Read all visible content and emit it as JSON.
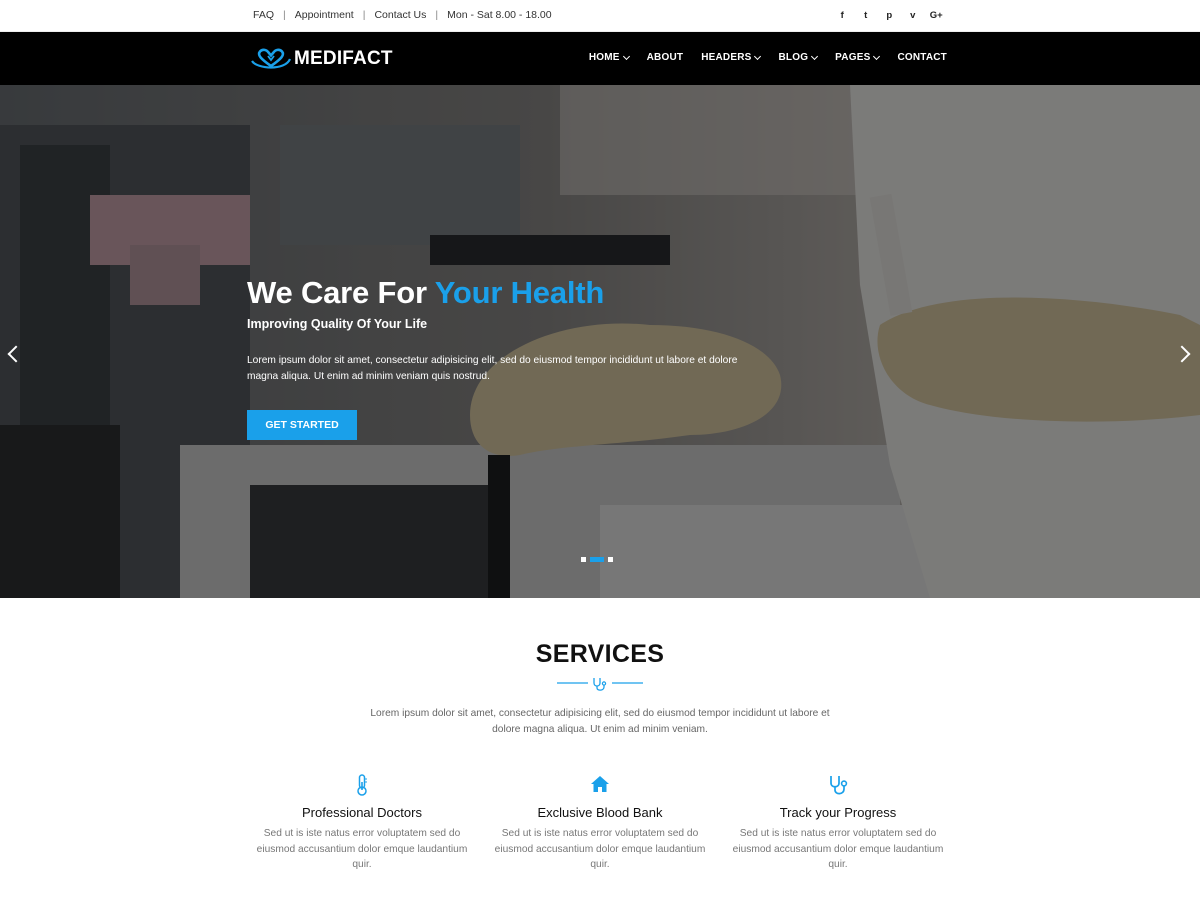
{
  "topbar": {
    "links": [
      "FAQ",
      "Appointment",
      "Contact Us"
    ],
    "hours": "Mon - Sat 8.00 - 18.00",
    "social": [
      {
        "name": "facebook-icon",
        "glyph": "f"
      },
      {
        "name": "twitter-icon",
        "glyph": "t"
      },
      {
        "name": "pinterest-icon",
        "glyph": "p"
      },
      {
        "name": "vimeo-icon",
        "glyph": "v"
      },
      {
        "name": "google-plus-icon",
        "glyph": "G+"
      }
    ]
  },
  "nav": {
    "logo_text": "MEDIFACT",
    "items": [
      {
        "label": "HOME",
        "dropdown": true
      },
      {
        "label": "ABOUT",
        "dropdown": false
      },
      {
        "label": "HEADERS",
        "dropdown": true
      },
      {
        "label": "BLOG",
        "dropdown": true
      },
      {
        "label": "PAGES",
        "dropdown": true
      },
      {
        "label": "CONTACT",
        "dropdown": false
      }
    ]
  },
  "hero": {
    "title_main": "We Care For ",
    "title_accent": "Your Health",
    "subtitle": "Improving Quality Of Your Life",
    "description": "Lorem ipsum dolor sit amet, consectetur adipisicing elit, sed do eiusmod tempor incididunt ut labore et dolore magna aliqua. Ut enim ad minim veniam quis nostrud.",
    "cta_label": "GET STARTED",
    "slides": 3,
    "active_slide": 2
  },
  "services": {
    "title": "SERVICES",
    "description": "Lorem ipsum dolor sit amet, consectetur adipisicing elit, sed do eiusmod tempor incididunt ut labore et dolore magna aliqua. Ut enim ad minim veniam.",
    "cards": [
      {
        "icon": "thermometer-icon",
        "title": "Professional Doctors",
        "text": "Sed ut is iste natus error voluptatem sed do eiusmod accusantium dolor emque laudantium quir."
      },
      {
        "icon": "home-icon",
        "title": "Exclusive Blood Bank",
        "text": "Sed ut is iste natus error voluptatem sed do eiusmod accusantium dolor emque laudantium quir."
      },
      {
        "icon": "stethoscope-icon",
        "title": "Track your Progress",
        "text": "Sed ut is iste natus error voluptatem sed do eiusmod accusantium dolor emque laudantium quir."
      }
    ]
  },
  "colors": {
    "accent": "#1aa0ea",
    "nav_bg": "#000000",
    "text_dark": "#111111",
    "text_muted": "#777777"
  }
}
